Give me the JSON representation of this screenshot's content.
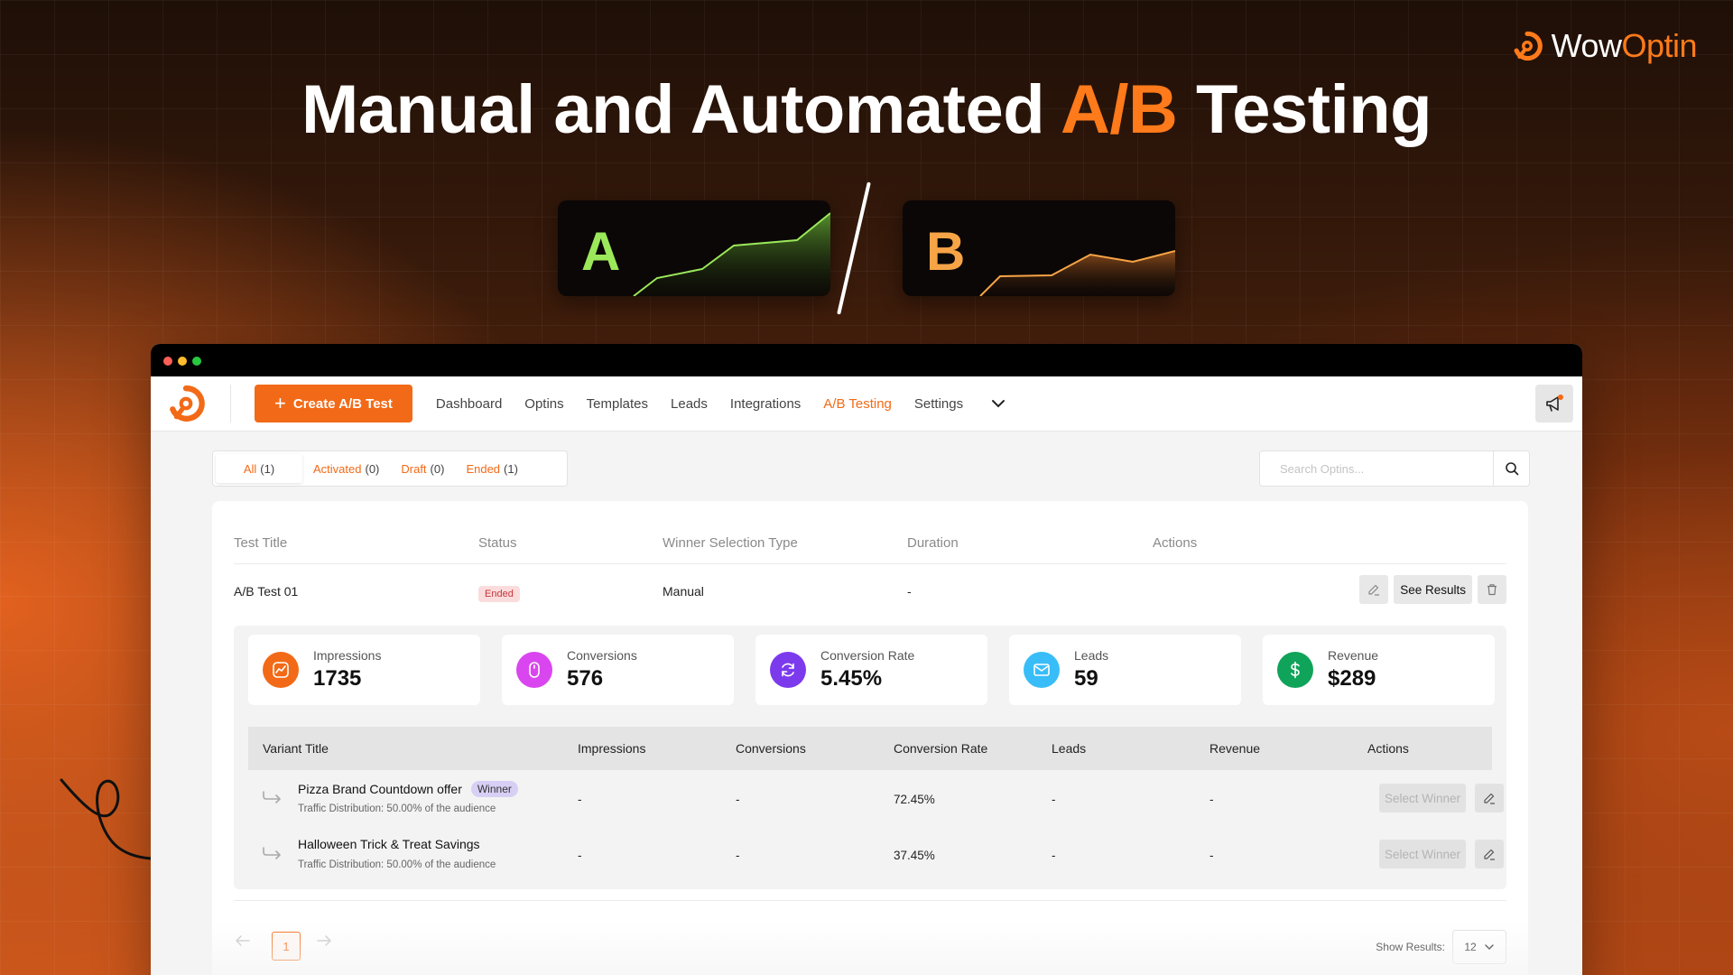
{
  "brand": {
    "name_part1": "Wow",
    "name_part2": "Optin"
  },
  "headline": {
    "part1": "Manual and Automated ",
    "accent": "A/B",
    "part2": " Testing"
  },
  "ab": {
    "a_label": "A",
    "b_label": "B",
    "a_color": "#9be85a",
    "b_color": "#f7a447"
  },
  "colors": {
    "accent": "#f26a17"
  },
  "nav": {
    "create_button": "Create A/B Test",
    "items": [
      "Dashboard",
      "Optins",
      "Templates",
      "Leads",
      "Integrations",
      "A/B Testing",
      "Settings"
    ],
    "active": "A/B Testing",
    "more_icon": "chevron-down-icon",
    "notify_icon": "megaphone-icon"
  },
  "filters": [
    {
      "label": "All",
      "count": "(1)"
    },
    {
      "label": "Activated",
      "count": "(0)"
    },
    {
      "label": "Draft",
      "count": "(0)"
    },
    {
      "label": "Ended",
      "count": "(1)"
    }
  ],
  "search": {
    "placeholder": "Search Optins..."
  },
  "table": {
    "headers": [
      "Test Title",
      "Status",
      "Winner Selection Type",
      "Duration",
      "Actions"
    ],
    "row": {
      "title": "A/B Test 01",
      "status": "Ended",
      "winner_type": "Manual",
      "duration": "-",
      "see_results": "See Results"
    }
  },
  "stats": [
    {
      "label": "Impressions",
      "value": "1735",
      "icon": "chart-icon",
      "color": "#f26a17"
    },
    {
      "label": "Conversions",
      "value": "576",
      "icon": "mouse-icon",
      "color": "#d946ef"
    },
    {
      "label": "Conversion Rate",
      "value": "5.45%",
      "icon": "refresh-icon",
      "color": "#7c3aed"
    },
    {
      "label": "Leads",
      "value": "59",
      "icon": "mail-icon",
      "color": "#38bdf8"
    },
    {
      "label": "Revenue",
      "value": "$289",
      "icon": "dollar-icon",
      "color": "#10a35a"
    }
  ],
  "variants": {
    "headers": [
      "Variant Title",
      "Impressions",
      "Conversions",
      "Conversion Rate",
      "Leads",
      "Revenue",
      "Actions"
    ],
    "rows": [
      {
        "title": "Pizza Brand Countdown offer",
        "badge": "Winner",
        "distribution": "Traffic Distribution: 50.00% of the audience",
        "impressions": "-",
        "conversions": "-",
        "conversion_rate": "72.45%",
        "leads": "-",
        "revenue": "-",
        "action": "Select Winner"
      },
      {
        "title": "Halloween Trick & Treat Savings",
        "badge": "",
        "distribution": "Traffic Distribution: 50.00% of the audience",
        "impressions": "-",
        "conversions": "-",
        "conversion_rate": "37.45%",
        "leads": "-",
        "revenue": "-",
        "action": "Select Winner"
      }
    ]
  },
  "pagination": {
    "page": "1",
    "show_results_label": "Show Results:",
    "page_size": "12"
  }
}
